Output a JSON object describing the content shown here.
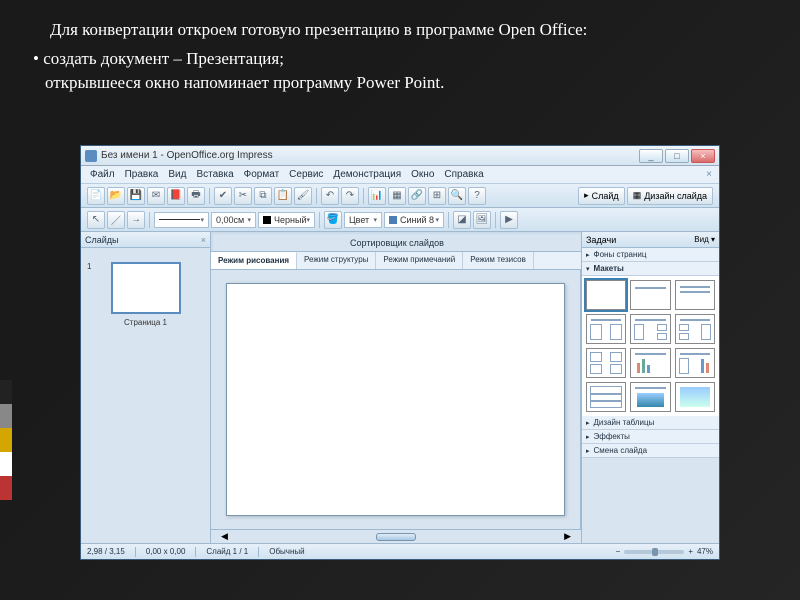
{
  "slide": {
    "intro": "Для конвертации откроем готовую презентацию в программе Open Office:",
    "bullet1": "создать документ – Презентация;",
    "line2": "открывшееся окно напоминает программу Power Point."
  },
  "window": {
    "title": "Без имени 1 - OpenOffice.org Impress",
    "min": "_",
    "max": "□",
    "close": "×"
  },
  "menu": [
    "Файл",
    "Правка",
    "Вид",
    "Вставка",
    "Формат",
    "Сервис",
    "Демонстрация",
    "Окно",
    "Справка"
  ],
  "toolbar1": {
    "right_btn_slide": "Слайд",
    "right_btn_design": "Дизайн слайда"
  },
  "toolbar2": {
    "size": "0,00см",
    "color_name": "Черный",
    "fill_label": "Цвет",
    "fill_color": "Синий 8"
  },
  "slides_panel": {
    "title": "Слайды",
    "num": "1",
    "caption": "Страница 1"
  },
  "view_tabs": {
    "main": "Сортировщик слайдов",
    "subs": [
      "Режим рисования",
      "Режим структуры",
      "Режим примечаний",
      "Режим тезисов"
    ]
  },
  "tasks": {
    "title": "Задачи",
    "view": "Вид ▾",
    "sec_fonts": "Фоны страниц",
    "sec_layouts": "Макеты",
    "sec_table": "Дизайн таблицы",
    "sec_effects": "Эффекты",
    "sec_change": "Смена слайда"
  },
  "status": {
    "coords": "2,98 / 3,15",
    "size": "0,00 x 0,00",
    "slide": "Слайд 1 / 1",
    "mode": "Обычный",
    "zoom": "47%"
  },
  "colors": {
    "accent": "#5b8cbf"
  }
}
